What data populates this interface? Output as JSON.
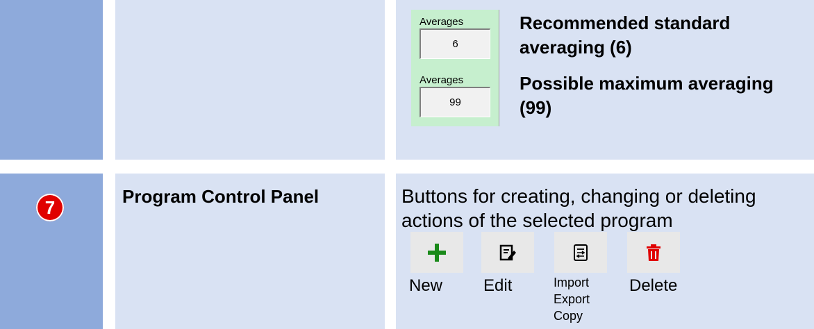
{
  "row6": {
    "averages_box_1": {
      "label": "Averages",
      "value": "6"
    },
    "averages_box_2": {
      "label": "Averages",
      "value": "99"
    },
    "text_1": "Recommended standard averaging (6)",
    "text_2": "Possible maximum averaging (99)"
  },
  "row7": {
    "number": "7",
    "title": "Program Control Panel",
    "description": "Buttons for creating, changing or deleting actions of the selected program",
    "buttons": [
      {
        "label": "New",
        "icon": "plus-icon",
        "color": "#1a8a1a"
      },
      {
        "label": "Edit",
        "icon": "edit-icon"
      },
      {
        "label_lines": [
          "Import",
          "Export",
          "Copy"
        ],
        "icon": "import-export-icon"
      },
      {
        "label": "Delete",
        "icon": "trash-icon",
        "color": "#e00000"
      }
    ]
  }
}
